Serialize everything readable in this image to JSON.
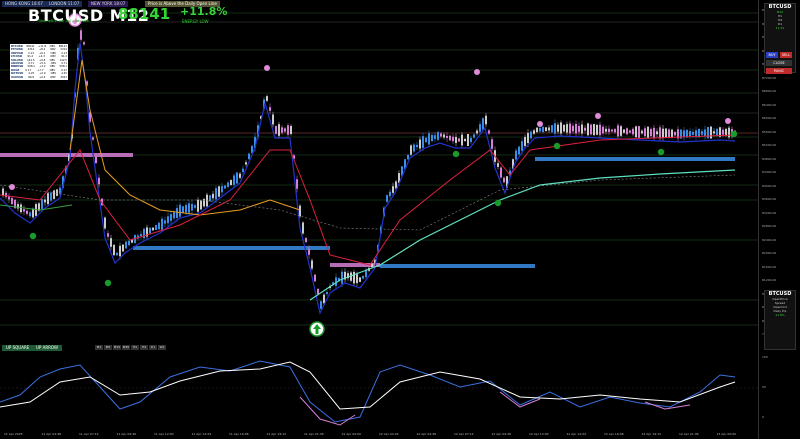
{
  "sessions": [
    {
      "label": "HONG KONG 18:07",
      "bg": "#1a2a55"
    },
    {
      "label": "LONDON 11:07",
      "bg": "#1a2a55"
    },
    {
      "label": "NEW YORK 18:07",
      "bg": "#2a1a55"
    }
  ],
  "banner": "Price is Above the Daily Open Line",
  "symbol": "BTCUSD M12",
  "subline": "Time left in bar 0:0 | Bar Size",
  "price": "88141",
  "change_pct": "+11.8%",
  "energy": "ENERGY LOW",
  "stats": [
    {
      "name": "BTCUSD",
      "a": "88141",
      "b": "+11.8",
      "c": "OBV",
      "d": "88141"
    },
    {
      "name": "ETHUSD",
      "a": "2314",
      "b": "+8.2",
      "c": "OBV",
      "d": "2314"
    },
    {
      "name": "XRPUSD",
      "a": "2.13",
      "b": "+6.1",
      "c": "OBV",
      "d": "2.13"
    },
    {
      "name": "LTCUSD",
      "a": "91.2",
      "b": "+4.3",
      "c": "OBV",
      "d": "91.2"
    },
    {
      "name": "SOLUSD",
      "a": "142.5",
      "b": "+9.8",
      "c": "OBV",
      "d": "142.5"
    },
    {
      "name": "ADAUSD",
      "a": "0.71",
      "b": "+5.4",
      "c": "OBV",
      "d": "0.71"
    },
    {
      "name": "BNBUSD",
      "a": "598.1",
      "b": "+3.2",
      "c": "OBV",
      "d": "598.1"
    },
    {
      "name": "DOGE",
      "a": "0.17",
      "b": "+7.7",
      "c": "OBV",
      "d": "0.17"
    },
    {
      "name": "DOTUSD",
      "a": "4.25",
      "b": "+2.9",
      "c": "OBV",
      "d": "4.25"
    },
    {
      "name": "XAUUSD",
      "a": "3021",
      "b": "+0.4",
      "c": "OBV",
      "d": "3021"
    }
  ],
  "buttons": {
    "up_square": "UP SQUARE",
    "up_arrow": "UP ARROW",
    "timeframes": [
      "M1",
      "M5",
      "M15",
      "M30",
      "H1",
      "H4",
      "D1",
      "W1"
    ]
  },
  "right_panel": {
    "symbol": "BTCUSD",
    "lines": [
      "M12",
      "H1",
      "H4",
      "D1",
      "11:31"
    ],
    "buy": "BUY",
    "sell": "SELL",
    "close": "CLOSE",
    "panic": "PANIC"
  },
  "right_panel2": {
    "symbol": "BTCUSD",
    "lines": [
      "OpenPrice",
      "Spread",
      "OpenOrd",
      "Daily P/L",
      "11.8%"
    ]
  },
  "yaxis_ticks": [
    "89200.00",
    "88800.00",
    "88400.00",
    "88000.00",
    "87600.00",
    "87200.00",
    "86800.00",
    "86400.00",
    "86000.00",
    "85600.00",
    "85200.00",
    "84800.00",
    "84400.00",
    "84000.00",
    "83600.00",
    "83200.00",
    "82800.00",
    "82400.00",
    "82000.00",
    "81600.00",
    "81200.00",
    "80800.00",
    "80400.00",
    "80000.00",
    "79600.00"
  ],
  "osc_ticks": [
    "100",
    "50",
    "0"
  ],
  "xaxis_ticks": [
    "11 Apr 2025",
    "11 Apr 04:48",
    "11 Apr 07:12",
    "11 Apr 09:36",
    "11 Apr 12:00",
    "11 Apr 14:24",
    "11 Apr 16:48",
    "11 Apr 19:12",
    "11 Apr 21:36",
    "12 Apr 00:00",
    "12 Apr 02:24",
    "12 Apr 04:48",
    "12 Apr 07:12",
    "12 Apr 09:36",
    "12 Apr 12:00",
    "12 Apr 14:24",
    "12 Apr 16:48",
    "12 Apr 19:12",
    "12 Apr 21:36",
    "13 Apr 00:00"
  ],
  "colors": {
    "bull_candle": "#3b8ee6",
    "bear_candle": "#d67fd6",
    "neutral_candle": "#cccccc",
    "ema_fast": "#2233cc",
    "ema_slow": "#e8a020",
    "red_line": "#e02040",
    "teal_line": "#60e0c0",
    "marker_green": "#1a9a2a",
    "marker_pink": "#e08ad8"
  }
}
